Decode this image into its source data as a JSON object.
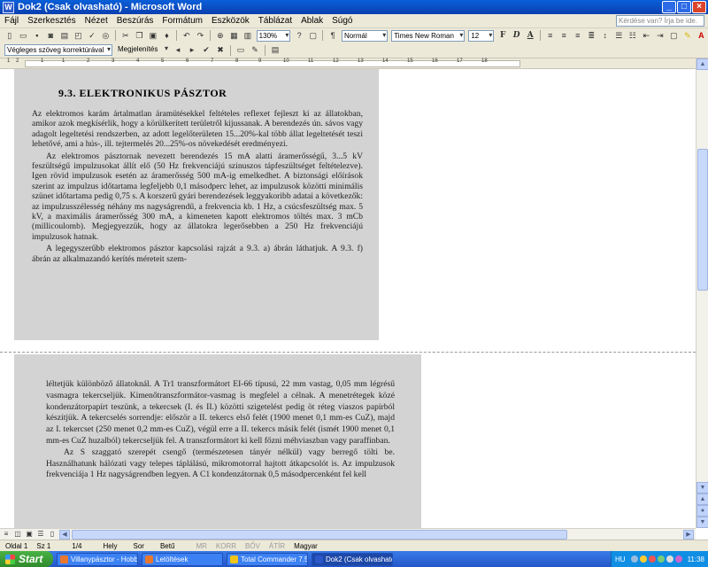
{
  "window": {
    "title": "Dok2 (Csak olvasható) - Microsoft Word"
  },
  "menu": {
    "items": [
      "Fájl",
      "Szerkesztés",
      "Nézet",
      "Beszúrás",
      "Formátum",
      "Eszközök",
      "Táblázat",
      "Ablak",
      "Súgó"
    ],
    "help_placeholder": "Kérdése van? Írja be ide."
  },
  "toolbar1": {
    "zoom": "130%",
    "style": "Normál",
    "font": "Times New Roman",
    "size": "12",
    "format_bold": "F",
    "format_italic": "D",
    "format_underline": "A"
  },
  "toolbar2": {
    "markup_mode": "Végleges szöveg korrektúrával",
    "show_menu": "Megjelenítés"
  },
  "ruler": {
    "marks": [
      "1",
      "2",
      "1",
      "1",
      "2",
      "3",
      "4",
      "5",
      "6",
      "7",
      "8",
      "9",
      "10",
      "11",
      "12",
      "13",
      "14",
      "15",
      "16",
      "17",
      "18"
    ]
  },
  "document": {
    "page1": {
      "heading": "9.3. ELEKTRONIKUS PÁSZTOR",
      "paragraphs": [
        "Az elektromos karám ártalmatlan áramütésekkel feltételes reflexet fejleszt ki az állatokban, amikor azok megkísérlik, hogy a körülkerített területről kijussanak. A berendezés ún. sávos vagy adagolt legeltetési rendszerben, az adott legelőterületen 15...20%-kal több állat legeltetését teszi lehetővé, ami a hús-, ill. tejtermelés 20...25%-os növekedését eredményezi.",
        "Az elektromos pásztornak nevezett berendezés 15 mA alatti áramerősségű, 3...5 kV feszültségű impulzusokat állít elő (50 Hz frekvenciájú szinuszos tápfeszültséget feltételezve). Igen rövid impulzusok esetén az áramerősség 500 mA-ig emelkedhet. A biztonsági előírások szerint az impulzus időtartama legfeljebb 0,1 másodperc lehet, az impulzusok közötti minimális szünet időtartama pedig 0,75 s. A korszerű gyári berendezések leggyakoribb adatai a következők: az impulzusszélesség néhány ms nagyságrendű, a frekvencia kb. 1 Hz, a csúcsfeszültség max. 5 kV, a maximális áramerősség 300 mA, a kimeneten kapott elektromos töltés max. 3 mCb (millicoulomb). Megjegyezzük, hogy az állatokra legerősebben a 250 Hz frekvenciájú impulzusok hatnak.",
        "A legegyszerűbb elektromos pásztor kapcsolási rajzát a 9.3. a) ábrán láthatjuk. A 9.3. f) ábrán az alkalmazandó kerítés méreteit szem-"
      ]
    },
    "page2": {
      "paragraphs": [
        "léltetjük különböző állatoknál. A Tr1 transzformátort EI-66 típusú, 22 mm vastag, 0,05 mm légrésű vasmagra tekercseljük. Kimenőtranszformátor-vasmag is megfelel a célnak. A menetrétegek közé kondenzátorpapírt teszünk, a tekercsek (I. és II.) közötti szigetelést pedig öt réteg viaszos papírból készítjük. A tekercselés sorrendje: először a II. tekercs első felét (1900 menet 0,1 mm-es CuZ), majd az I. tekercset (250 menet 0,2 mm-es CuZ), végül erre a II. tekercs másik felét (ismét 1900 menet 0,1 mm-es CuZ huzalból) tekercseljük fel. A transzformátort ki kell főzni méhviaszban vagy paraffinban.",
        "Az S szaggató szerepét csengő (természetesen tányér nélkül) vagy berregő tölti be. Használhatunk hálózati vagy telepes táplálású, mikromotorral hajtott átkapcsolót is. Az impulzusok frekvenciája 1 Hz nagyságrendben legyen. A C1 kondenzátornak 0,5 másodpercenként fel kell"
      ]
    }
  },
  "statusbar": {
    "page": "Oldal 1",
    "section": "Sz 1",
    "pages": "1/4",
    "position": "Hely",
    "line": "Sor",
    "column": "Betű",
    "mr": "MR",
    "korr": "KORR",
    "bov": "BŐV",
    "atir": "ÁTÍR",
    "language": "Magyar"
  },
  "taskbar": {
    "start": "Start",
    "tasks": [
      {
        "label": "Villanypásztor - Hobbi...",
        "color": "#e8772e"
      },
      {
        "label": "Letöltések",
        "color": "#e8772e"
      },
      {
        "label": "Total Commander 7.5...",
        "color": "#f0c419"
      },
      {
        "label": "Dok2 (Csak olvasható...",
        "color": "#2b57c9"
      }
    ],
    "lang": "HU",
    "clock": "11:38"
  }
}
